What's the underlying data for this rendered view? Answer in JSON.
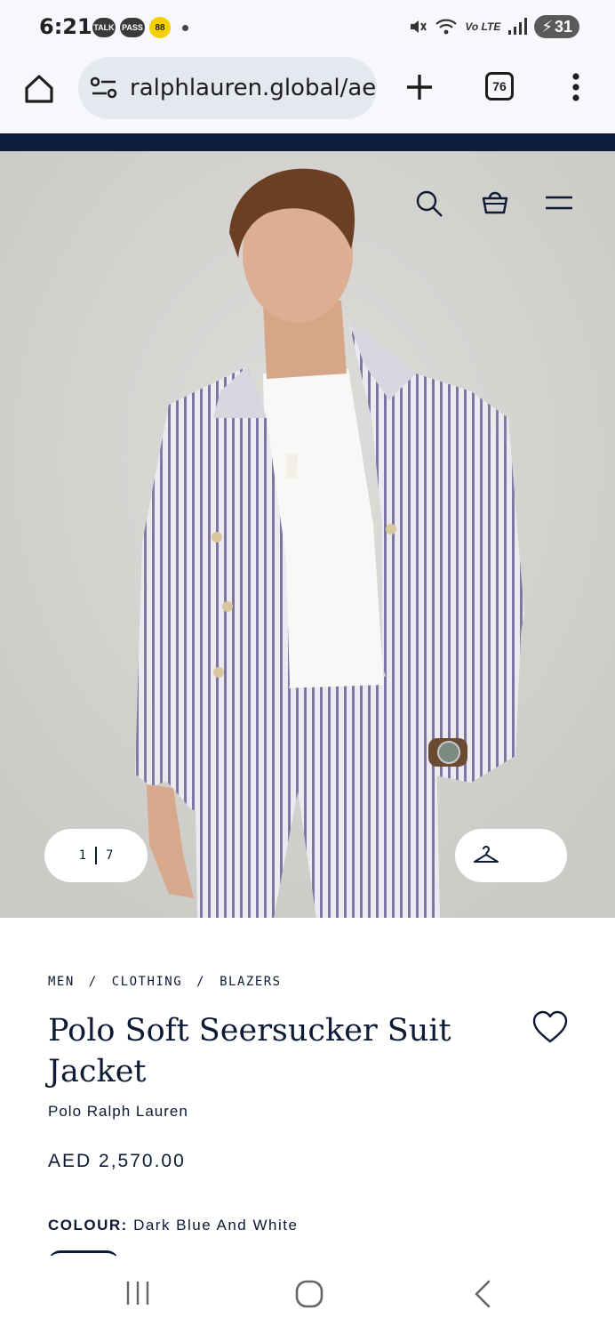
{
  "status_bar": {
    "time": "6:21",
    "notifications": [
      "TALK",
      "PASS",
      "88"
    ],
    "network": "Vo LTE",
    "battery": "31"
  },
  "browser": {
    "url": "ralphlauren.global/ae",
    "tab_count": "76"
  },
  "gallery": {
    "current": "1",
    "total": "7"
  },
  "breadcrumb": [
    "MEN",
    "/",
    "CLOTHING",
    "/",
    "BLAZERS"
  ],
  "product": {
    "title": "Polo Soft Seersucker Suit Jacket",
    "brand": "Polo Ralph Lauren",
    "price": "AED 2,570.00",
    "colour_label": "COLOUR:",
    "colour_value": "Dark Blue And White"
  },
  "icons": {
    "home": "home-icon",
    "site_settings": "site-settings-icon",
    "new_tab": "plus-icon",
    "tabs": "tabs-icon",
    "menu": "more-vert-icon",
    "search": "search-icon",
    "bag": "shopping-bag-icon",
    "hamburger": "hamburger-menu-icon",
    "hanger": "hanger-icon",
    "wishlist": "heart-icon"
  },
  "colors": {
    "navy": "#0c1e3c",
    "text": "#0c1a33",
    "hero_bg": "#d7d6d2"
  }
}
